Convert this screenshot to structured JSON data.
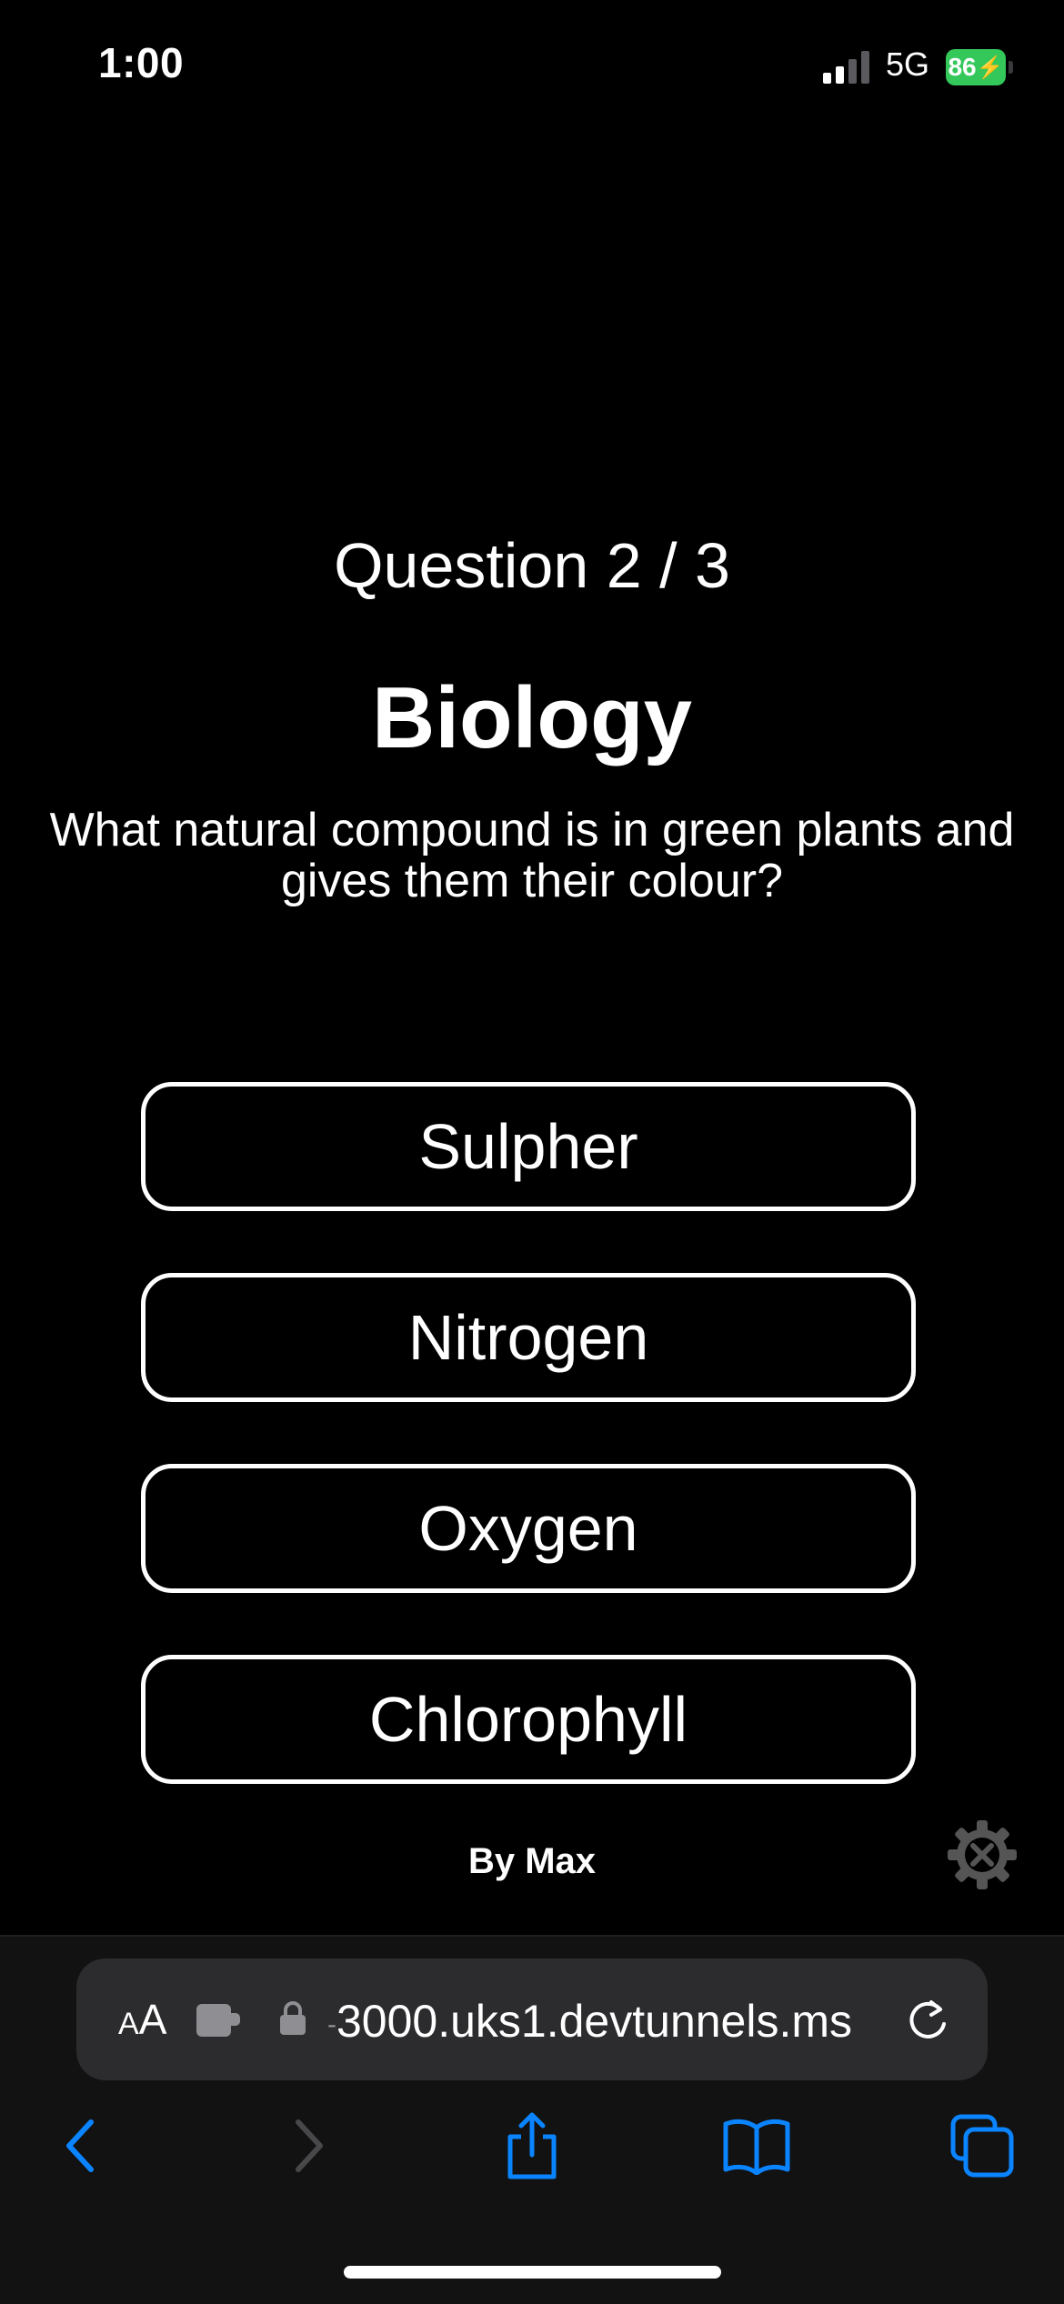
{
  "status_bar": {
    "time": "1:00",
    "network": "5G",
    "battery": "86"
  },
  "quiz": {
    "counter": "Question 2 / 3",
    "subject": "Biology",
    "question": "What natural compound is in green plants and gives them their colour?",
    "answers": [
      "Sulpher",
      "Nitrogen",
      "Oxygen",
      "Chlorophyll"
    ],
    "credit": "By Max"
  },
  "browser": {
    "text_size_label_small": "A",
    "text_size_label_large": "A",
    "url": "3000.uks1.devtunnels.ms"
  },
  "colors": {
    "background": "#000000",
    "accent_blue": "#0a84ff",
    "battery_green": "#34c759",
    "browser_bar": "#121212",
    "url_pill": "#2c2c2e"
  },
  "icons": {
    "status": [
      "cellular-signal-icon",
      "battery-charging-icon"
    ],
    "page": [
      "settings-gear-icon"
    ],
    "browser": [
      "extension-icon",
      "lock-icon",
      "reload-icon",
      "back-icon",
      "forward-icon",
      "share-icon",
      "bookmarks-icon",
      "tabs-icon"
    ]
  }
}
